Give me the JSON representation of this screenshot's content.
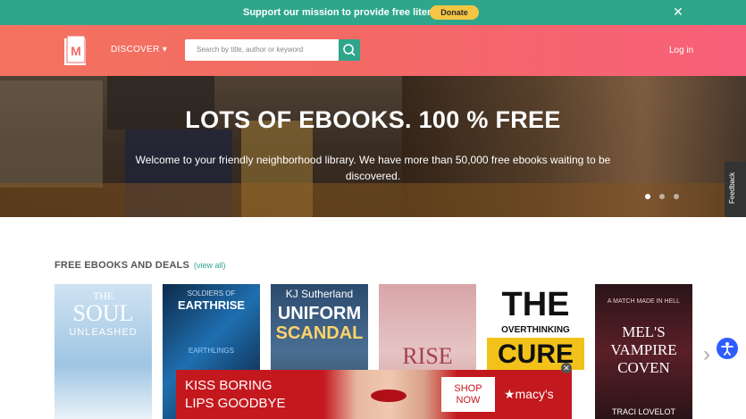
{
  "banner": {
    "message": "Support our mission to provide free literature!",
    "donate_label": "Donate",
    "close_icon": "close-icon"
  },
  "header": {
    "discover_label": "DISCOVER ▾",
    "search_placeholder": "Search by title, author or keyword",
    "login_label": "Log in",
    "colors": {
      "gradient_start": "#f3735f",
      "gradient_end": "#f8607a",
      "accent": "#2fa68c"
    }
  },
  "hero": {
    "title": "LOTS OF EBOOKS. 100 % FREE",
    "subtitle_line1": "Welcome to your friendly neighborhood library. We have more than 50,000 free ebooks waiting to be",
    "subtitle_line2": "discovered.",
    "feedback_label": "Feedback"
  },
  "section": {
    "title": "FREE EBOOKS AND DEALS",
    "view_all": "(view all)"
  },
  "books": [
    {
      "line1": "THE",
      "line2": "SOUL",
      "line3": "UNLEASHED"
    },
    {
      "line1": "SOLDIERS OF",
      "line2": "EARTHRISE",
      "line3": "EARTHLINGS"
    },
    {
      "line1": "KJ Sutherland",
      "line2": "UNIFORM",
      "line3": "SCANDAL"
    },
    {
      "line1": "RISE"
    },
    {
      "line1": "THE",
      "line2": "OVERTHINKING",
      "line3": "CURE"
    },
    {
      "line1": "A MATCH MADE IN HELL",
      "line2": "MEL'S VAMPIRE COVEN",
      "line3": "TRACI LOVELOT"
    }
  ],
  "ad": {
    "line1": "KISS BORING",
    "line2": "LIPS GOODBYE",
    "shop_line1": "SHOP",
    "shop_line2": "NOW",
    "brand": "★macy's"
  }
}
